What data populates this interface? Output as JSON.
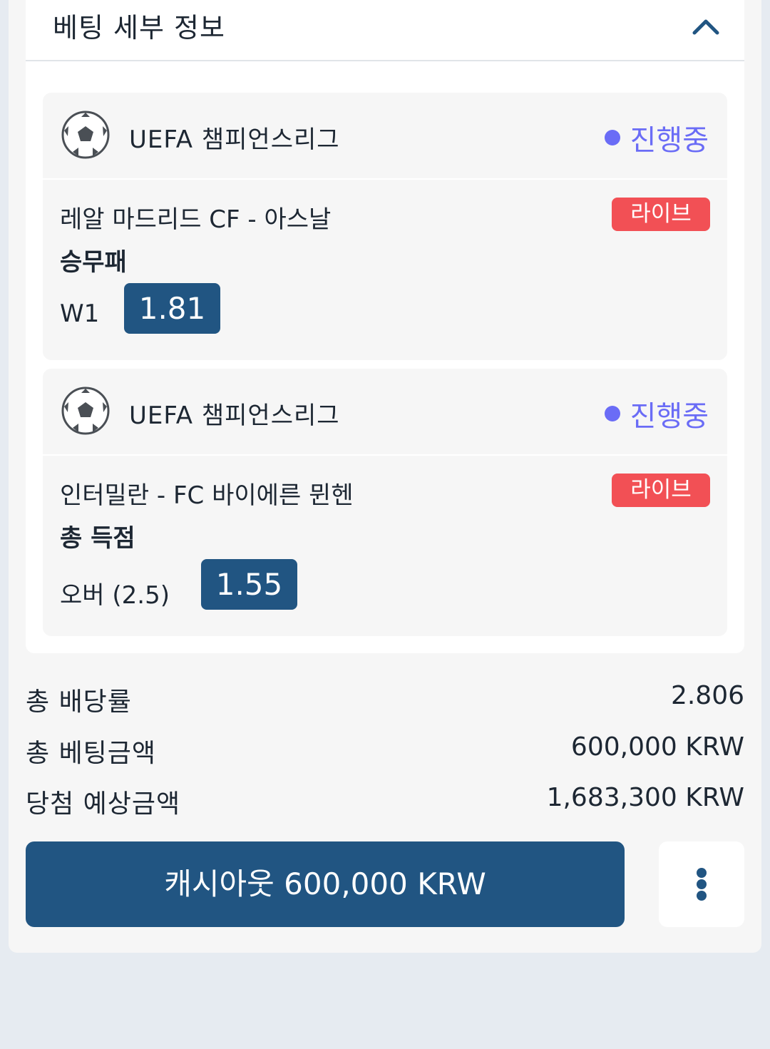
{
  "details": {
    "title": "베팅 세부 정보"
  },
  "bets": [
    {
      "league": "UEFA 챔피언스리그",
      "status": "진행중",
      "match": "레알 마드리드 CF - 아스날",
      "badge": "라이브",
      "market": "승무패",
      "selection": "W1",
      "odds": "1.81"
    },
    {
      "league": "UEFA 챔피언스리그",
      "status": "진행중",
      "match": "인터밀란 - FC 바이에른 뮌헨",
      "badge": "라이브",
      "market": "총 득점",
      "selection": "오버 (2.5)",
      "odds": "1.55"
    }
  ],
  "summary": {
    "total_odds_label": "총 배당률",
    "total_odds_value": "2.806",
    "total_stake_label": "총 베팅금액",
    "total_stake_value": "600,000 KRW",
    "potential_win_label": "당첨 예상금액",
    "potential_win_value": "1,683,300 KRW"
  },
  "actions": {
    "cashout_label": "캐시아웃 600,000 KRW"
  },
  "icons": {
    "collapse": "chevron-up-icon",
    "league": "soccer-ball-icon",
    "more": "more-vertical-icon"
  },
  "colors": {
    "primary": "#215582",
    "live_badge": "#f25055",
    "status": "#6a6cf6",
    "background": "#e6ebf1"
  }
}
